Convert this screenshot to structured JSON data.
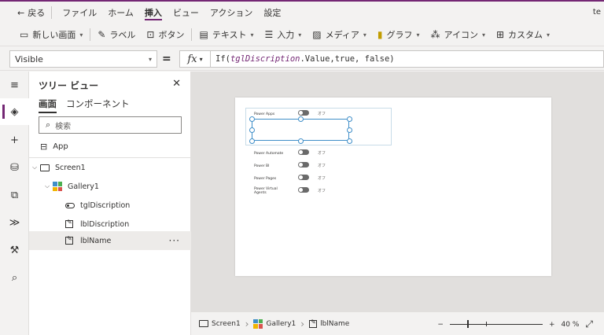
{
  "menu": {
    "back_label": "戻る",
    "items": [
      "ファイル",
      "ホーム",
      "挿入",
      "ビュー",
      "アクション",
      "設定"
    ],
    "active": "挿入",
    "user_text": "te"
  },
  "ribbon": {
    "new_screen": "新しい画面",
    "label": "ラベル",
    "button": "ボタン",
    "text": "テキスト",
    "input": "入力",
    "media": "メディア",
    "chart": "グラフ",
    "icons": "アイコン",
    "custom": "カスタム"
  },
  "formula": {
    "property": "Visible",
    "equals": "=",
    "fx": "fx",
    "expr_prefix": "If(",
    "expr_var": "tglDiscription",
    "expr_suffix": ".Value,true, false)"
  },
  "tree": {
    "title": "ツリー ビュー",
    "tabs": [
      "画面",
      "コンポーネント"
    ],
    "search_placeholder": "検索",
    "app_label": "App",
    "nodes": [
      {
        "label": "Screen1"
      },
      {
        "label": "Gallery1"
      },
      {
        "label": "tglDiscription"
      },
      {
        "label": "lblDiscription"
      },
      {
        "label": "lblName"
      }
    ],
    "more": "···"
  },
  "canvas": {
    "rows": [
      {
        "name": "Power Apps",
        "state": "オフ"
      },
      {
        "name": "Power Automate",
        "state": "オフ"
      },
      {
        "name": "Power BI",
        "state": "オフ"
      },
      {
        "name": "Power Pages",
        "state": "オフ"
      },
      {
        "name": "Power Virtual Agents",
        "state": "オフ"
      }
    ]
  },
  "status": {
    "crumbs": [
      "Screen1",
      "Gallery1",
      "lblName"
    ],
    "zoom_minus": "−",
    "zoom_plus": "+",
    "zoom_value": "40",
    "zoom_unit": "%"
  }
}
